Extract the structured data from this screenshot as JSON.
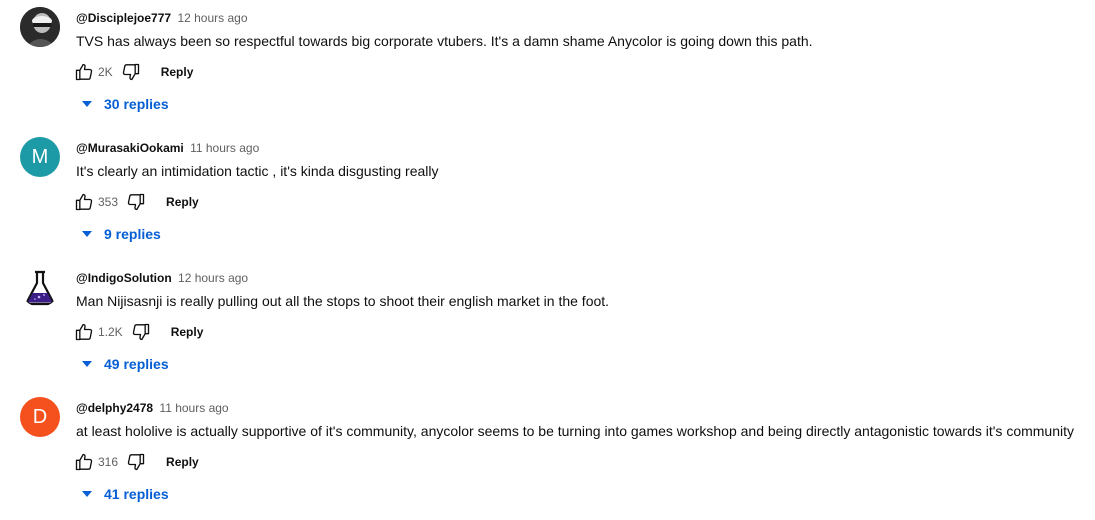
{
  "comments": [
    {
      "author": "@Disciplejoe777",
      "time": "12 hours ago",
      "text": "TVS has always been so respectful towards big corporate vtubers. It's a damn shame Anycolor is going down this path.",
      "likes": "2K",
      "reply_label": "Reply",
      "replies_label": "30 replies",
      "avatar": {
        "type": "photo",
        "icon": "person-photo"
      }
    },
    {
      "author": "@MurasakiOokami",
      "time": "11 hours ago",
      "text": "It's clearly an intimidation tactic , it's kinda disgusting really",
      "likes": "353",
      "reply_label": "Reply",
      "replies_label": "9 replies",
      "avatar": {
        "type": "letter",
        "letter": "M",
        "color": "#1c9aa5"
      }
    },
    {
      "author": "@IndigoSolution",
      "time": "12 hours ago",
      "text": "Man Nijisasnji is really pulling out all the stops to shoot their english market in the foot.",
      "likes": "1.2K",
      "reply_label": "Reply",
      "replies_label": "49 replies",
      "avatar": {
        "type": "icon",
        "icon": "flask-icon",
        "color": "#3b1f86"
      }
    },
    {
      "author": "@delphy2478",
      "time": "11 hours ago",
      "text": "at least hololive is actually supportive of it's community, anycolor seems to be turning into games workshop and being directly antagonistic towards it's community",
      "likes": "316",
      "reply_label": "Reply",
      "replies_label": "41 replies",
      "avatar": {
        "type": "letter",
        "letter": "D",
        "color": "#f4511e"
      }
    }
  ],
  "colors": {
    "link_blue": "#065fd4",
    "secondary_text": "#606060",
    "primary_text": "#0f0f0f"
  }
}
